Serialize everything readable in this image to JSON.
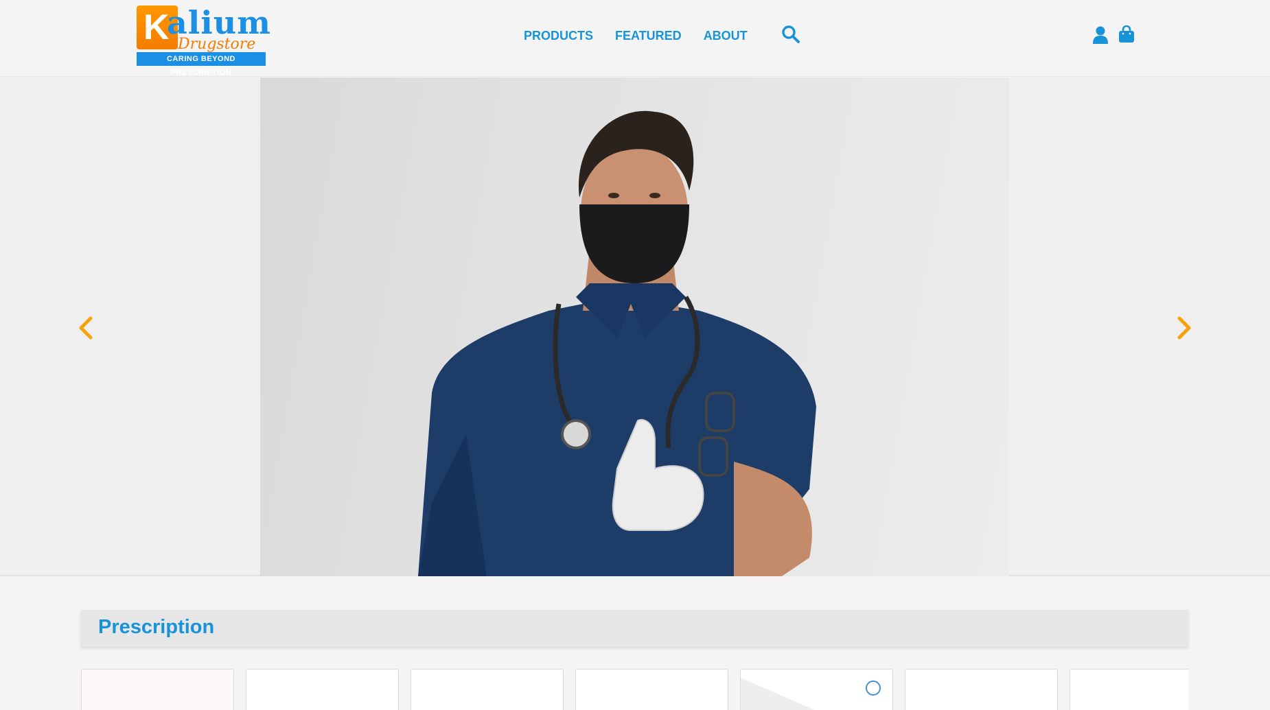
{
  "brand": {
    "logo_letter": "K",
    "logo_word": "alium",
    "logo_sub": "Drugstore",
    "tagline": "CARING BEYOND PRESCRIPTION"
  },
  "nav": {
    "items": [
      {
        "label": "PRODUCTS"
      },
      {
        "label": "FEATURED"
      },
      {
        "label": "ABOUT"
      }
    ]
  },
  "icons": {
    "search": "search-icon",
    "user": "user-icon",
    "cart": "shopping-bag-icon",
    "prev": "chevron-left-icon",
    "next": "chevron-right-icon"
  },
  "colors": {
    "accent_blue": "#1893d8",
    "accent_orange": "#f5a20b",
    "background": "#f4f4f4"
  },
  "section": {
    "title": "Prescription"
  },
  "product_cards_visible": 7
}
